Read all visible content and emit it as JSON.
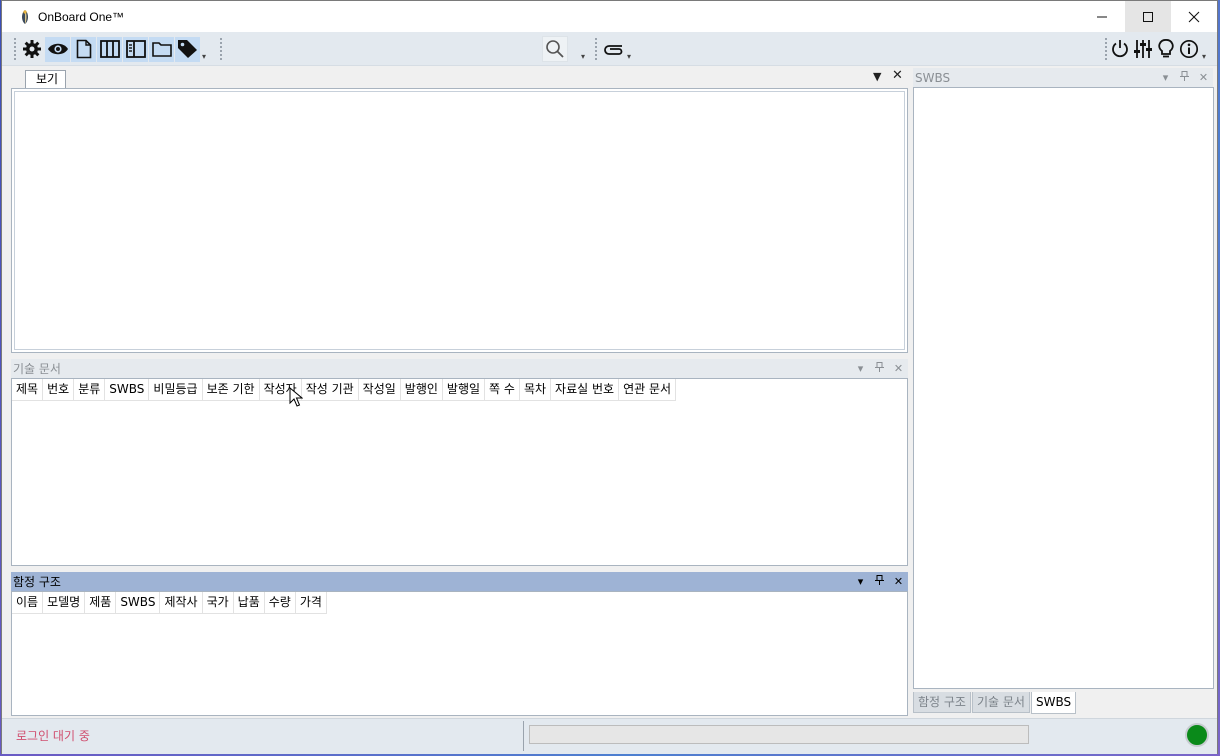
{
  "window": {
    "title": "OnBoard One™"
  },
  "toolbar": {
    "left_icons": [
      "gear-icon",
      "eye-icon",
      "document-icon",
      "columns-icon",
      "sidebar-icon",
      "folder-icon",
      "tag-icon"
    ],
    "middle_icons": [
      "search-icon",
      "paperclip-icon"
    ],
    "right_icons": [
      "power-icon",
      "sliders-icon",
      "lightbulb-icon",
      "info-icon"
    ]
  },
  "view_pane": {
    "tab_label": "보기"
  },
  "tech_docs_pane": {
    "title": "기술 문서",
    "columns": [
      "제목",
      "번호",
      "분류",
      "SWBS",
      "비밀등급",
      "보존 기한",
      "작성자",
      "작성 기관",
      "작성일",
      "발행인",
      "발행일",
      "쪽 수",
      "목차",
      "자료실 번호",
      "연관 문서"
    ]
  },
  "ship_structure_pane": {
    "title": "함정 구조",
    "columns": [
      "이름",
      "모델명",
      "제품",
      "SWBS",
      "제작사",
      "국가",
      "납품",
      "수량",
      "가격"
    ]
  },
  "swbs_pane": {
    "title": "SWBS",
    "bottom_tabs": [
      "함정 구조",
      "기술 문서",
      "SWBS"
    ],
    "active_tab": "SWBS"
  },
  "statusbar": {
    "status_text": "로그인 대기 중",
    "progress": 0,
    "indicator_color": "#0a8a1a"
  }
}
